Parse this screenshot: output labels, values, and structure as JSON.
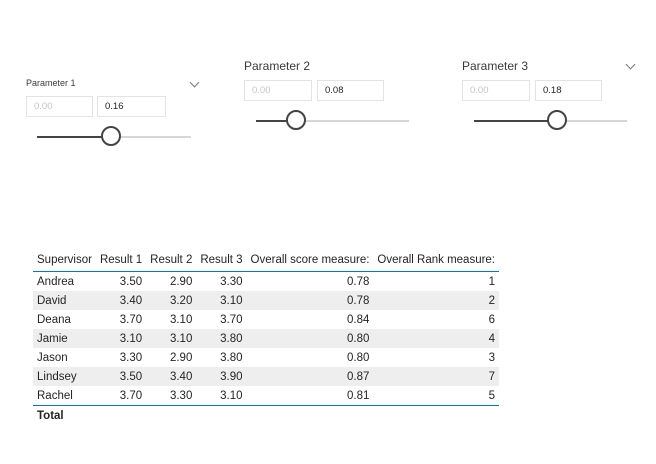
{
  "slicers": [
    {
      "title": "Parameter 1",
      "min": "0.00",
      "max": "0.16",
      "fraction": 0.48
    },
    {
      "title": "Parameter 2",
      "min": "0.00",
      "max": "0.08",
      "fraction": 0.26
    },
    {
      "title": "Parameter 3",
      "min": "0.00",
      "max": "0.18",
      "fraction": 0.54
    }
  ],
  "table": {
    "headers": [
      "Supervisor",
      "Result 1",
      "Result 2",
      "Result 3",
      "Overall score measure:",
      "Overall Rank measure:"
    ],
    "rows": [
      [
        "Andrea",
        "3.50",
        "2.90",
        "3.30",
        "0.78",
        "1"
      ],
      [
        "David",
        "3.40",
        "3.20",
        "3.10",
        "0.78",
        "2"
      ],
      [
        "Deana",
        "3.70",
        "3.10",
        "3.70",
        "0.84",
        "6"
      ],
      [
        "Jamie",
        "3.10",
        "3.10",
        "3.80",
        "0.80",
        "4"
      ],
      [
        "Jason",
        "3.30",
        "2.90",
        "3.80",
        "0.80",
        "3"
      ],
      [
        "Lindsey",
        "3.50",
        "3.40",
        "3.90",
        "0.87",
        "7"
      ],
      [
        "Rachel",
        "3.70",
        "3.30",
        "3.10",
        "0.81",
        "5"
      ]
    ],
    "total_label": "Total"
  }
}
